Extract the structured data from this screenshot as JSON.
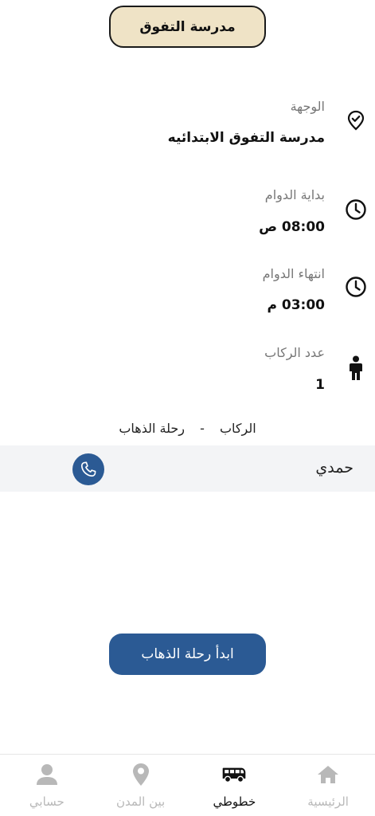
{
  "header": {
    "school_name": "مدرسة التفوق"
  },
  "details": {
    "destination": {
      "label": "الوجهة",
      "value": "مدرسة التفوق الابتدائيه",
      "icon": "location-check-icon"
    },
    "start_time": {
      "label": "بداية الدوام",
      "value": "08:00 ص",
      "icon": "clock-icon"
    },
    "end_time": {
      "label": "انتهاء الدوام",
      "value": "03:00 م",
      "icon": "clock-icon"
    },
    "riders_count": {
      "label": "عدد الركاب",
      "value": "1",
      "icon": "person-icon"
    }
  },
  "trip_section": {
    "riders_label": "الركاب",
    "separator": "-",
    "trip_label": "رحلة الذهاب"
  },
  "passengers": [
    {
      "name": "حمدي",
      "call_icon": "phone-icon"
    }
  ],
  "actions": {
    "start_trip_label": "ابدأ رحلة الذهاب"
  },
  "colors": {
    "accent": "#2b5a94",
    "header_bg": "#efe3c6",
    "row_bg": "#f3f4f6",
    "inactive_nav": "#b8b8b8"
  },
  "bottom_nav": {
    "items": [
      {
        "label": "حسابي",
        "icon": "user-icon",
        "active": false
      },
      {
        "label": "بين المدن",
        "icon": "map-pin-icon",
        "active": false
      },
      {
        "label": "خطوطي",
        "icon": "bus-icon",
        "active": true
      },
      {
        "label": "الرئيسية",
        "icon": "home-icon",
        "active": false
      }
    ]
  }
}
